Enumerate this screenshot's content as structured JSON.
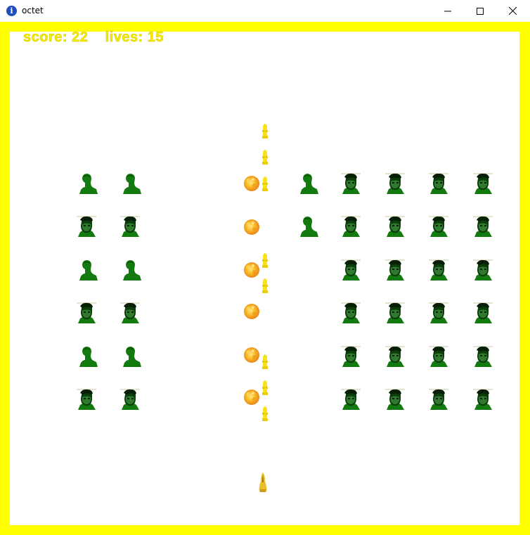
{
  "window": {
    "title": "octet",
    "controls": [
      "minimize-icon",
      "maximize-icon",
      "close-icon"
    ]
  },
  "hud": {
    "score_label": "score: 22",
    "lives_label": "lives: 15"
  },
  "colors": {
    "frame": "#ffff00",
    "hud_text": "#f5ec00",
    "enemy_dark": "#0d3d0d",
    "enemy_green": "#137a10",
    "fireball": "#f7a41d",
    "bullet": "#f7e21b"
  },
  "sprites": {
    "enemy_face": "soldier-face-icon",
    "enemy_silhouette": "green-silhouette-icon",
    "fireball": "fireball-icon",
    "bullet": "bullet-icon",
    "player": "player-ship-icon"
  }
}
